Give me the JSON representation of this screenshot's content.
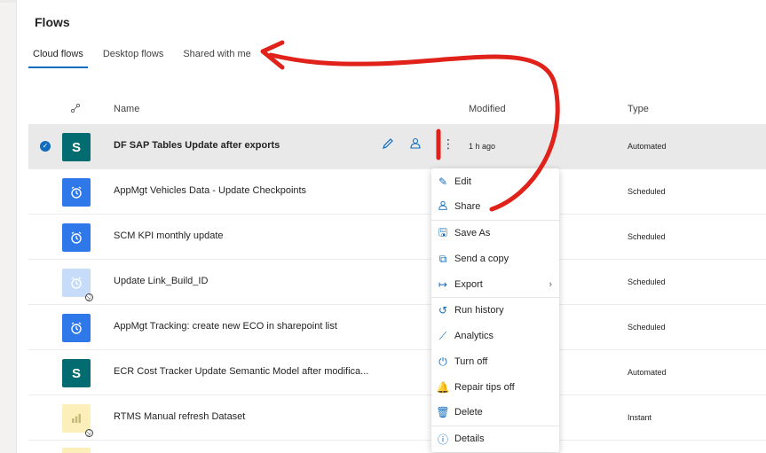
{
  "page_title": "Flows",
  "tabs": [
    {
      "label": "Cloud flows",
      "active": true
    },
    {
      "label": "Desktop flows",
      "active": false
    },
    {
      "label": "Shared with me",
      "active": false
    }
  ],
  "columns": {
    "name": "Name",
    "modified": "Modified",
    "type": "Type"
  },
  "rows": [
    {
      "name": "DF SAP Tables Update after exports",
      "modified": "1 h ago",
      "type": "Automated",
      "icon": "sharepoint-icon",
      "color": "#036c70",
      "selected": true
    },
    {
      "name": "AppMgt Vehicles Data - Update Checkpoints",
      "modified": "",
      "type": "Scheduled",
      "icon": "alarm-clock-icon",
      "color": "#2f78ea"
    },
    {
      "name": "SCM KPI monthly update",
      "modified": "",
      "type": "Scheduled",
      "icon": "alarm-clock-icon",
      "color": "#2f78ea"
    },
    {
      "name": "Update Link_Build_ID",
      "modified": "",
      "type": "Scheduled",
      "icon": "alarm-clock-icon",
      "color": "#c7dcf9",
      "off": true
    },
    {
      "name": "AppMgt Tracking: create new ECO in sharepoint list",
      "modified": "",
      "type": "Scheduled",
      "icon": "alarm-clock-icon",
      "color": "#2f78ea"
    },
    {
      "name": "ECR Cost Tracker Update Semantic Model after modifica...",
      "modified": "",
      "type": "Automated",
      "icon": "sharepoint-icon",
      "color": "#036c70"
    },
    {
      "name": "RTMS Manual refresh Dataset",
      "modified": "",
      "type": "Instant",
      "icon": "powerbi-icon",
      "color": "#fcefba",
      "off": true
    }
  ],
  "context_menu": {
    "items": [
      {
        "label": "Edit",
        "icon": "pencil-icon"
      },
      {
        "label": "Share",
        "icon": "share-icon"
      },
      {
        "label": "Save As",
        "icon": "save-icon"
      },
      {
        "label": "Send a copy",
        "icon": "copy-icon"
      },
      {
        "label": "Export",
        "icon": "export-icon"
      },
      {
        "label": "Run history",
        "icon": "history-icon"
      },
      {
        "label": "Analytics",
        "icon": "analytics-icon"
      },
      {
        "label": "Turn off",
        "icon": "power-icon"
      },
      {
        "label": "Repair tips off",
        "icon": "bell-icon"
      },
      {
        "label": "Delete",
        "icon": "trash-icon"
      },
      {
        "label": "Details",
        "icon": "info-icon"
      }
    ]
  },
  "accent_color": "#0f6cbd",
  "annotation_color": "#e0221b"
}
